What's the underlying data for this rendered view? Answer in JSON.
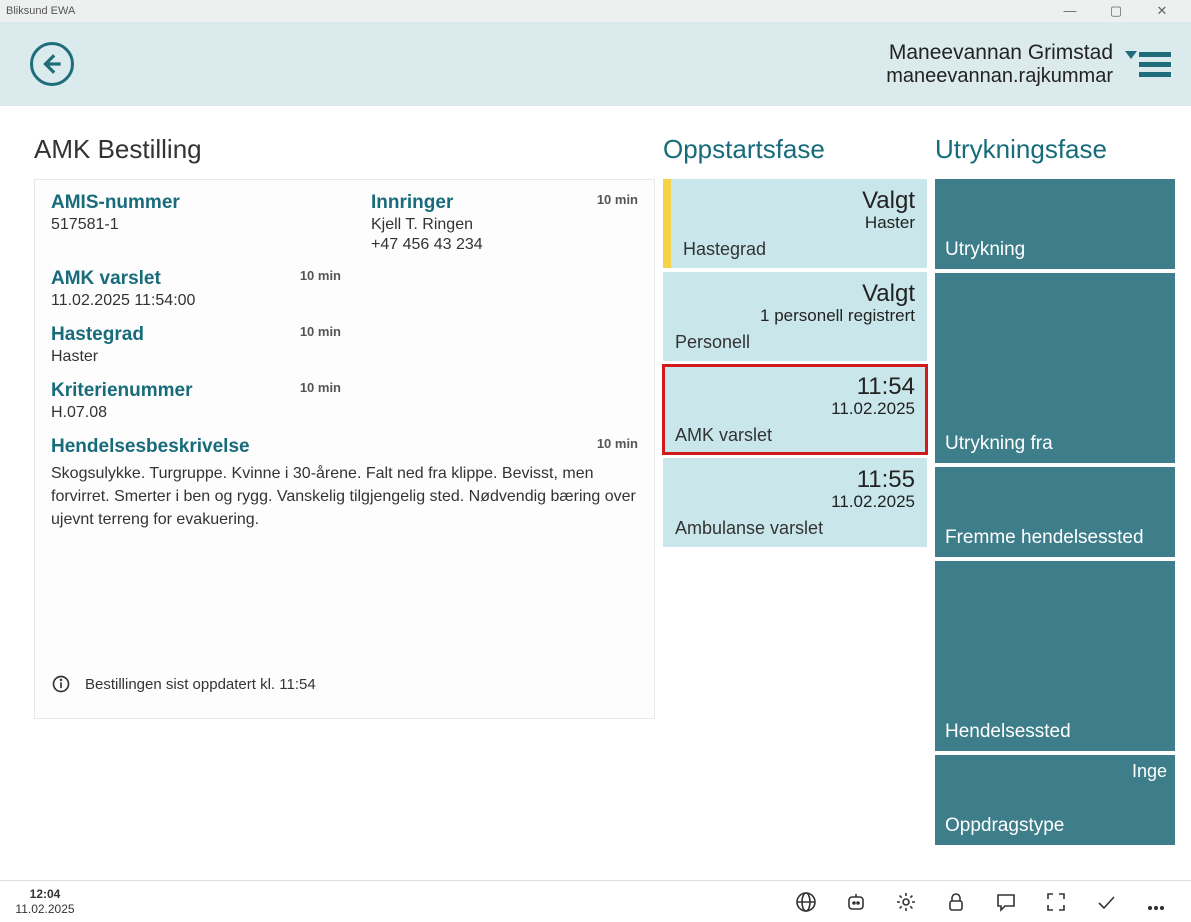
{
  "window": {
    "title": "Bliksund EWA"
  },
  "header": {
    "user_name": "Maneevannan Grimstad",
    "user_login": "maneevannan.rajkummar"
  },
  "left": {
    "section_title": "AMK Bestilling",
    "amis": {
      "label": "AMIS-nummer",
      "value": "517581-1"
    },
    "innringer": {
      "label": "Innringer",
      "name": "Kjell T. Ringen",
      "phone": "+47 456 43 234",
      "badge": "10 min"
    },
    "amk_varslet": {
      "label": "AMK varslet",
      "value": "11.02.2025 11:54:00",
      "badge": "10 min"
    },
    "hastegrad": {
      "label": "Hastegrad",
      "value": "Haster",
      "badge": "10 min"
    },
    "kriterienummer": {
      "label": "Kriterienummer",
      "value": "H.07.08",
      "badge": "10 min"
    },
    "hendelse": {
      "label": "Hendelsesbeskrivelse",
      "badge": "10 min",
      "text": "Skogsulykke. Turgruppe. Kvinne i 30-årene. Falt ned fra klippe. Bevisst, men forvirret. Smerter i ben og rygg. Vanskelig tilgjengelig sted. Nødvendig bæring over ujevnt terreng for evakuering."
    },
    "info_line": "Bestillingen sist oppdatert kl. 11:54"
  },
  "mid": {
    "section_title": "Oppstartsfase",
    "cards": [
      {
        "top": "Valgt",
        "sub": "Haster",
        "foot": "Hastegrad"
      },
      {
        "top": "Valgt",
        "sub": "1 personell registrert",
        "foot": "Personell"
      },
      {
        "top": "11:54",
        "sub": "11.02.2025",
        "foot": "AMK varslet"
      },
      {
        "top": "11:55",
        "sub": "11.02.2025",
        "foot": "Ambulanse varslet"
      }
    ]
  },
  "right": {
    "section_title": "Utrykningsfase",
    "tiles": [
      {
        "label": "Utrykning"
      },
      {
        "label": "Utrykning fra"
      },
      {
        "label": "Fremme hendelsessted"
      },
      {
        "label": "Hendelsessted"
      },
      {
        "label": "Oppdragstype",
        "corner": "Inge"
      }
    ]
  },
  "bottom": {
    "time": "12:04",
    "date": "11.02.2025"
  }
}
